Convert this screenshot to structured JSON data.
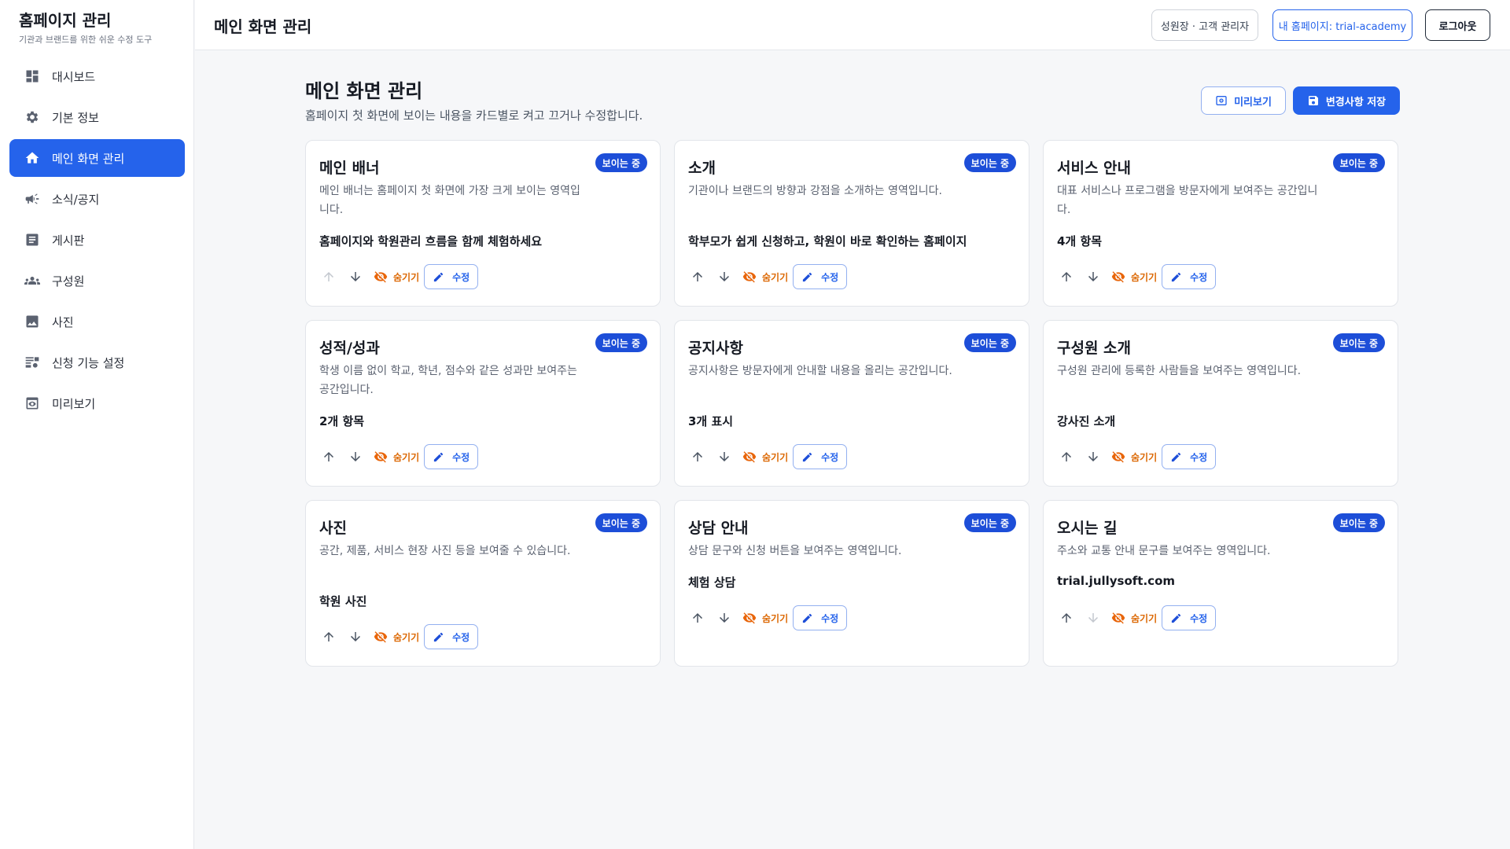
{
  "brand": {
    "title": "홈페이지 관리",
    "subtitle": "기관과 브랜드를 위한 쉬운 수정 도구"
  },
  "sidebar": {
    "items": [
      {
        "label": "대시보드",
        "icon": "dashboard-icon",
        "active": false
      },
      {
        "label": "기본 정보",
        "icon": "gear-icon",
        "active": false
      },
      {
        "label": "메인 화면 관리",
        "icon": "home-icon",
        "active": true
      },
      {
        "label": "소식/공지",
        "icon": "megaphone-icon",
        "active": false
      },
      {
        "label": "게시판",
        "icon": "board-icon",
        "active": false
      },
      {
        "label": "구성원",
        "icon": "people-icon",
        "active": false
      },
      {
        "label": "사진",
        "icon": "image-icon",
        "active": false
      },
      {
        "label": "신청 기능 설정",
        "icon": "form-settings-icon",
        "active": false
      },
      {
        "label": "미리보기",
        "icon": "preview-icon",
        "active": false
      }
    ]
  },
  "header": {
    "title": "메인 화면 관리",
    "user_label": "성원장 · 고객 관리자",
    "site_label": "내 홈페이지: trial-academy",
    "logout_label": "로그아웃"
  },
  "main": {
    "heading": "메인 화면 관리",
    "description": "홈페이지 첫 화면에 보이는 내용을 카드별로 켜고 끄거나 수정합니다.",
    "preview_label": "미리보기",
    "save_label": "변경사항 저장",
    "hide_label": "숨기기",
    "edit_label": "수정",
    "visible_badge": "보이는 중",
    "cards": [
      {
        "title": "메인 배너",
        "description": "메인 배너는 홈페이지 첫 화면에 가장 크게 보이는 영역입니다.",
        "highlight": "홈페이지와 학원관리 흐름을 함께 체험하세요",
        "up_enabled": false,
        "down_enabled": true,
        "lines": 2
      },
      {
        "title": "소개",
        "description": "기관이나 브랜드의 방향과 강점을 소개하는 영역입니다.",
        "highlight": "학부모가 쉽게 신청하고, 학원이 바로 확인하는 홈페이지",
        "up_enabled": true,
        "down_enabled": true,
        "lines": 2
      },
      {
        "title": "서비스 안내",
        "description": "대표 서비스나 프로그램을 방문자에게 보여주는 공간입니다.",
        "highlight": "4개 항목",
        "up_enabled": true,
        "down_enabled": true,
        "lines": 2
      },
      {
        "title": "성적/성과",
        "description": "학생 이름 없이 학교, 학년, 점수와 같은 성과만 보여주는 공간입니다.",
        "highlight": "2개 항목",
        "up_enabled": true,
        "down_enabled": true,
        "lines": 2
      },
      {
        "title": "공지사항",
        "description": "공지사항은 방문자에게 안내할 내용을 올리는 공간입니다.",
        "highlight": "3개 표시",
        "up_enabled": true,
        "down_enabled": true,
        "lines": 2
      },
      {
        "title": "구성원 소개",
        "description": "구성원 관리에 등록한 사람들을 보여주는 영역입니다.",
        "highlight": "강사진 소개",
        "up_enabled": true,
        "down_enabled": true,
        "lines": 2
      },
      {
        "title": "사진",
        "description": "공간, 제품, 서비스 현장 사진 등을 보여줄 수 있습니다.",
        "highlight": "학원 사진",
        "up_enabled": true,
        "down_enabled": true,
        "lines": 2
      },
      {
        "title": "상담 안내",
        "description": "상담 문구와 신청 버튼을 보여주는 영역입니다.",
        "highlight": "체험 상담",
        "up_enabled": true,
        "down_enabled": true,
        "lines": 1
      },
      {
        "title": "오시는 길",
        "description": "주소와 교통 안내 문구를 보여주는 영역입니다.",
        "highlight": "trial.jullysoft.com",
        "up_enabled": true,
        "down_enabled": false,
        "lines": 1
      }
    ]
  },
  "colors": {
    "primary": "#2563eb",
    "hide_orange": "#e8650a",
    "badge": "#1d4ed8"
  }
}
